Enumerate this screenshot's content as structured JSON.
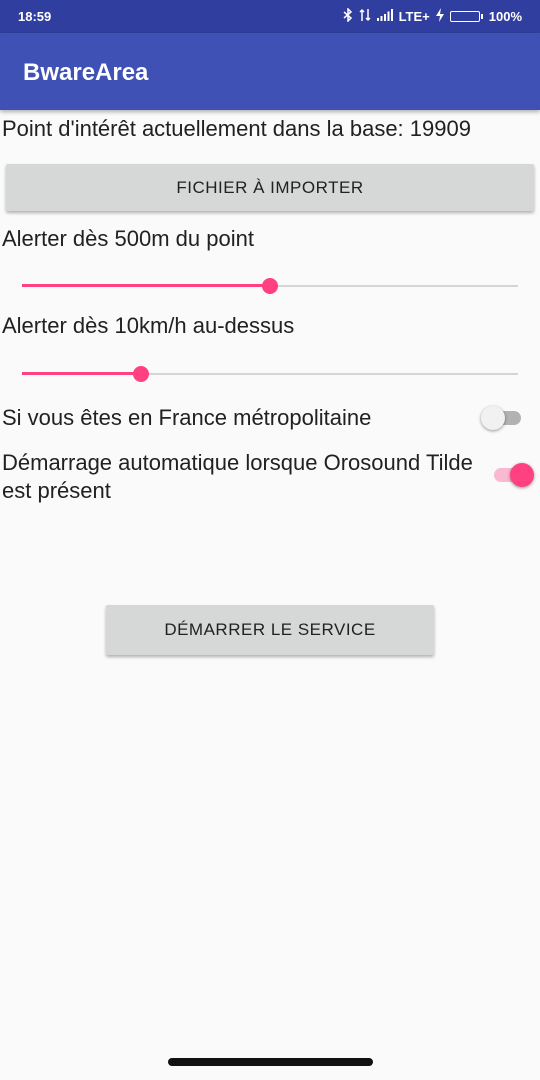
{
  "status_bar": {
    "time": "18:59",
    "network": "LTE+",
    "battery": "100%",
    "battery_level": 1.0,
    "icons": [
      "bluetooth-icon",
      "data-arrows-icon",
      "signal-icon",
      "charging-icon",
      "battery-icon"
    ]
  },
  "app_bar": {
    "title": "BwareArea"
  },
  "content": {
    "poi_count_text": "Point d'intérêt actuellement dans la base: 19909",
    "import_button": "FICHIER À IMPORTER",
    "distance_label": "Alerter dès 500m du point",
    "distance_slider_fraction": 0.5,
    "speed_label": "Alerter dès 10km/h au-dessus",
    "speed_slider_fraction": 0.24,
    "france_label": "Si vous êtes en France métropolitaine",
    "france_switch_on": false,
    "auto_start_label": "Démarrage automatique lorsque Orosound Tilde est présent",
    "auto_start_switch_on": true,
    "start_button": "DÉMARRER LE SERVICE"
  },
  "colors": {
    "primary": "#3f51b5",
    "primary_dark": "#303f9f",
    "accent": "#ff4081",
    "background": "#fafafa",
    "button": "#d6d7d7"
  }
}
